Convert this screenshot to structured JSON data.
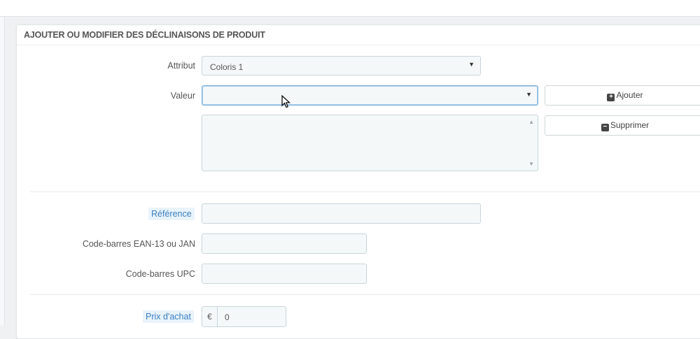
{
  "panel": {
    "title": "AJOUTER OU MODIFIER DES DÉCLINAISONS DE PRODUIT"
  },
  "form": {
    "attribut_label": "Attribut",
    "attribut_value": "Coloris 1",
    "valeur_label": "Valeur",
    "valeur_value": "",
    "add_button": "Ajouter",
    "delete_button": "Supprimer",
    "reference_label": "Référence",
    "reference_value": "",
    "ean_label": "Code-barres EAN-13 ou JAN",
    "ean_value": "",
    "upc_label": "Code-barres UPC",
    "upc_value": "",
    "prix_achat_label": "Prix d'achat",
    "currency_symbol": "€",
    "prix_achat_value": "0"
  },
  "colors": {
    "accent": "#3a7fc1",
    "field_bg": "#f5f8f9",
    "highlight_bg": "#e9f3fb"
  },
  "icons": {
    "add": "plus-square-icon",
    "delete": "minus-square-icon",
    "dropdown": "caret-down-icon",
    "cursor": "mouse-pointer-icon"
  }
}
